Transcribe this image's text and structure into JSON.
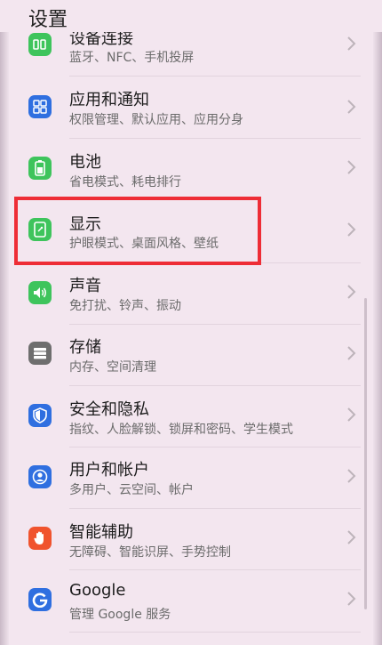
{
  "header": {
    "title": "设置"
  },
  "items": [
    {
      "title": "设备连接",
      "subtitle": "蓝牙、NFC、手机投屏",
      "icon": "device-connection-icon",
      "color": "#3ec45c"
    },
    {
      "title": "应用和通知",
      "subtitle": "权限管理、默认应用、应用分身",
      "icon": "apps-grid-icon",
      "color": "#2f6fe0"
    },
    {
      "title": "电池",
      "subtitle": "省电模式、耗电排行",
      "icon": "battery-icon",
      "color": "#3ec45c"
    },
    {
      "title": "显示",
      "subtitle": "护眼模式、桌面风格、壁纸",
      "icon": "display-icon",
      "color": "#3ec45c"
    },
    {
      "title": "声音",
      "subtitle": "免打扰、铃声、振动",
      "icon": "speaker-icon",
      "color": "#3ec45c"
    },
    {
      "title": "存储",
      "subtitle": "内存、空间清理",
      "icon": "storage-icon",
      "color": "#6e6e6e"
    },
    {
      "title": "安全和隐私",
      "subtitle": "指纹、人脸解锁、锁屏和密码、学生模式",
      "icon": "shield-icon",
      "color": "#2f6fe0"
    },
    {
      "title": "用户和帐户",
      "subtitle": "多用户、云空间、帐户",
      "icon": "user-icon",
      "color": "#2f6fe0"
    },
    {
      "title": "智能辅助",
      "subtitle": "无障碍、智能识屏、手势控制",
      "icon": "hand-icon",
      "color": "#f0532d"
    },
    {
      "title": "Google",
      "subtitle": "管理 Google 服务",
      "icon": "google-icon",
      "color": "#2f6fe0"
    }
  ]
}
